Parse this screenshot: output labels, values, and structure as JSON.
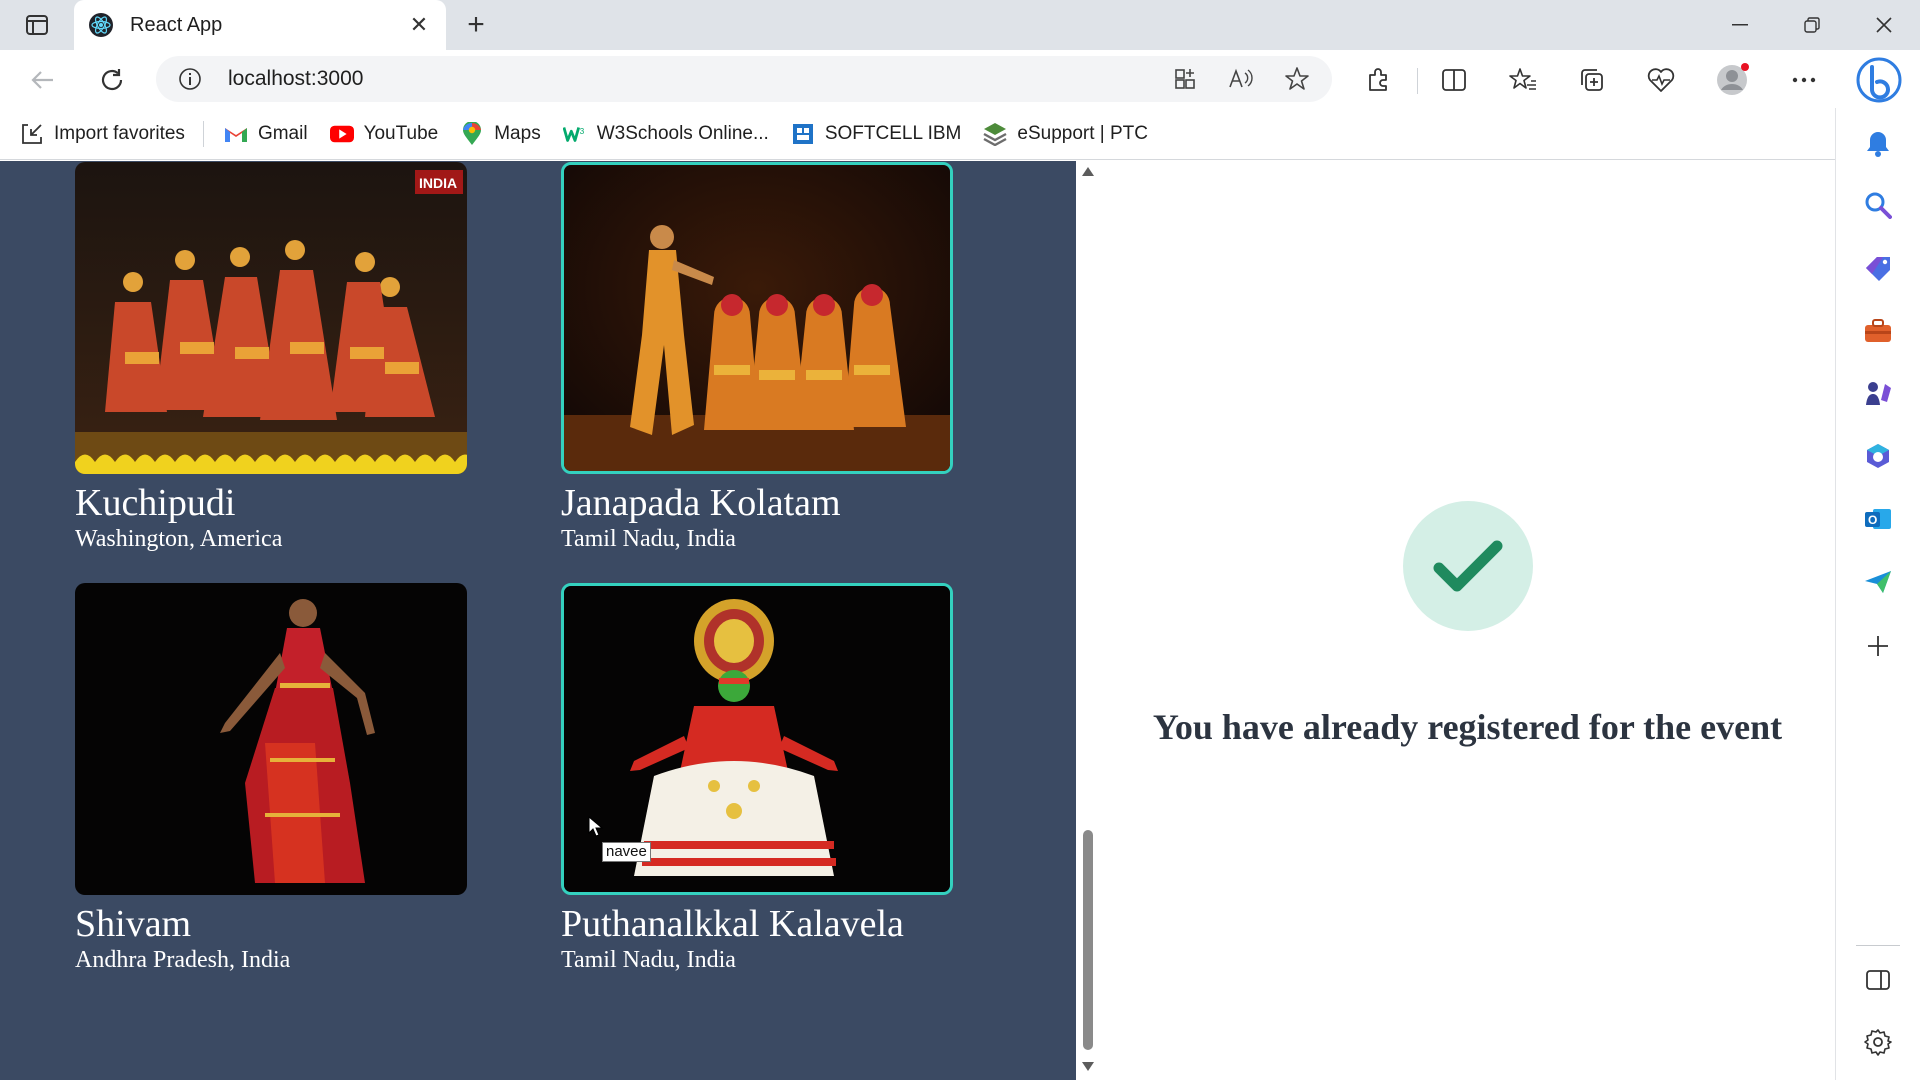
{
  "browser": {
    "tab_title": "React App",
    "url": "localhost:3000"
  },
  "favorites": [
    {
      "label": "Import favorites",
      "icon": "import-icon"
    },
    {
      "label": "Gmail",
      "icon": "gmail-icon"
    },
    {
      "label": "YouTube",
      "icon": "youtube-icon"
    },
    {
      "label": "Maps",
      "icon": "maps-icon"
    },
    {
      "label": "W3Schools Online...",
      "icon": "w3schools-icon"
    },
    {
      "label": "SOFTCELL IBM",
      "icon": "softcell-icon"
    },
    {
      "label": "eSupport | PTC",
      "icon": "esupport-icon"
    }
  ],
  "events": [
    {
      "name": "Kuchipudi",
      "location": "Washington, America",
      "selected": false
    },
    {
      "name": "Janapada Kolatam",
      "location": "Tamil Nadu, India",
      "selected": true
    },
    {
      "name": "Shivam",
      "location": "Andhra Pradesh, India",
      "selected": false
    },
    {
      "name": "Puthanalkkal Kalavela",
      "location": "Tamil Nadu, India",
      "selected": true
    }
  ],
  "image_logo_text": "INDIA",
  "tooltip": "navee",
  "registration": {
    "message": "You have already registered for the event"
  },
  "colors": {
    "page_bg": "#3b4a63",
    "accent_border": "#34d1bf",
    "check_green": "#1f8a5e",
    "check_bg": "#d4efe6"
  }
}
